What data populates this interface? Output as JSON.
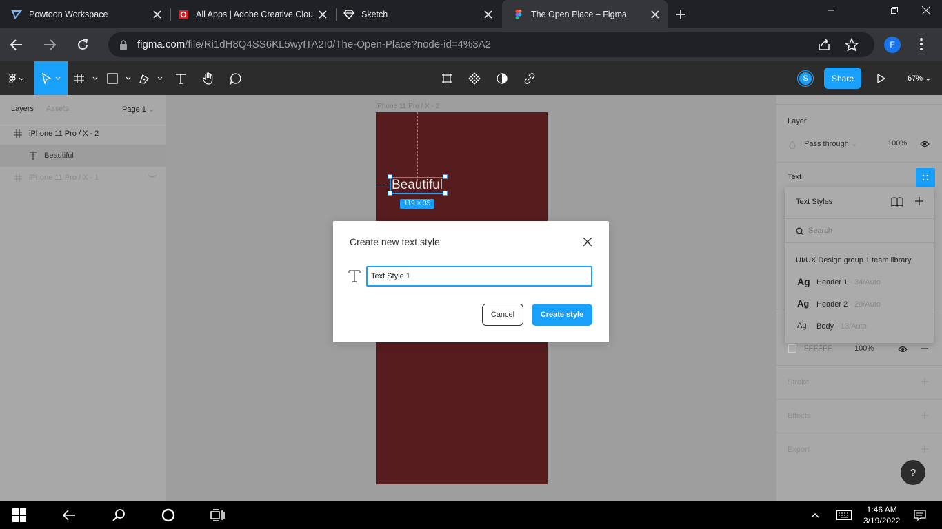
{
  "browser": {
    "tabs": [
      {
        "title": "Powtoon Workspace",
        "icon": "powtoon-icon"
      },
      {
        "title": "All Apps | Adobe Creative Clou",
        "icon": "adobe-cc-icon"
      },
      {
        "title": "Sketch",
        "icon": "sketch-icon"
      },
      {
        "title": "The Open Place – Figma",
        "icon": "figma-icon",
        "active": true
      }
    ],
    "url_host": "figma.com",
    "url_path": "/file/Ri1dH8Q4SS6KL5wyITA2I0/The-Open-Place?node-id=4%3A2",
    "profile_initial": "F"
  },
  "figma_toolbar": {
    "avatar_initial": "S",
    "share_label": "Share",
    "zoom": "67%"
  },
  "left_panel": {
    "tab_layers": "Layers",
    "tab_assets": "Assets",
    "page": "Page 1",
    "layers": [
      {
        "name": "iPhone 11 Pro / X - 2",
        "type": "frame"
      },
      {
        "name": "Beautiful",
        "type": "text"
      },
      {
        "name": "iPhone 11 Pro / X - 1",
        "type": "frame"
      }
    ]
  },
  "canvas": {
    "artboard_label": "iPhone 11 Pro / X - 2",
    "text_layer": "Beautiful",
    "size_badge": "119 × 35"
  },
  "modal": {
    "title": "Create new text style",
    "input_value": "Text Style 1",
    "cancel_label": "Cancel",
    "create_label": "Create style"
  },
  "right_panel": {
    "layer_heading": "Layer",
    "blend_mode": "Pass through",
    "layer_opacity": "100%",
    "text_heading": "Text",
    "fill_hex": "FFFFFF",
    "fill_opacity": "100%",
    "stroke_heading": "Stroke",
    "effects_heading": "Effects",
    "export_heading": "Export"
  },
  "text_styles_popup": {
    "title": "Text Styles",
    "search_placeholder": "Search",
    "library": "UI/UX Design group 1 team library",
    "styles": [
      {
        "sample": "Ag",
        "name": "Header 1",
        "meta": "· 34/Auto"
      },
      {
        "sample": "Ag",
        "name": "Header 2",
        "meta": "· 20/Auto"
      },
      {
        "sample": "Ag",
        "name": "Body",
        "meta": "· 13/Auto"
      }
    ]
  },
  "help_label": "?",
  "taskbar": {
    "time": "1:46 AM",
    "date": "3/19/2022"
  },
  "colors": {
    "figma_blue": "#18a0fb",
    "artboard": "#561c1e",
    "toolbar": "#2c2c2c"
  }
}
